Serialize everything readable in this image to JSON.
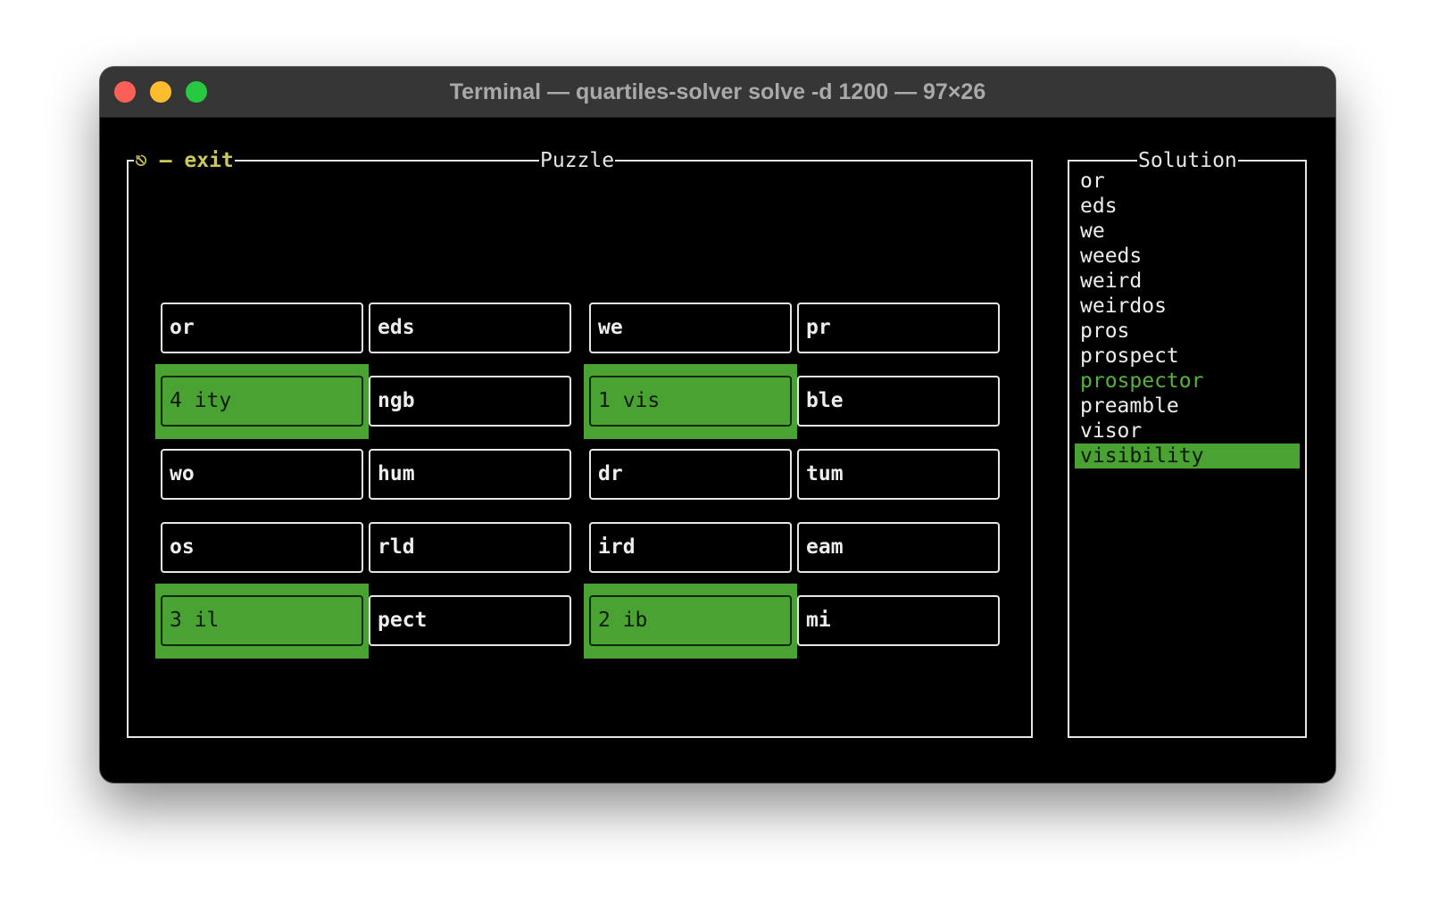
{
  "window": {
    "title": "Terminal — quartiles-solver solve -d 1200 — 97×26"
  },
  "puzzle_panel": {
    "title": "Puzzle",
    "exit_hint": "⎋ – exit",
    "tiles": [
      {
        "label": "or",
        "selected": false
      },
      {
        "label": "eds",
        "selected": false
      },
      {
        "label": "we",
        "selected": false
      },
      {
        "label": "pr",
        "selected": false
      },
      {
        "label": "4 ity",
        "selected": true
      },
      {
        "label": "ngb",
        "selected": false
      },
      {
        "label": "1 vis",
        "selected": true
      },
      {
        "label": "ble",
        "selected": false
      },
      {
        "label": "wo",
        "selected": false
      },
      {
        "label": "hum",
        "selected": false
      },
      {
        "label": "dr",
        "selected": false
      },
      {
        "label": "tum",
        "selected": false
      },
      {
        "label": "os",
        "selected": false
      },
      {
        "label": "rld",
        "selected": false
      },
      {
        "label": "ird",
        "selected": false
      },
      {
        "label": "eam",
        "selected": false
      },
      {
        "label": "3 il",
        "selected": true
      },
      {
        "label": "pect",
        "selected": false
      },
      {
        "label": "2 ib",
        "selected": true
      },
      {
        "label": "mi",
        "selected": false
      }
    ]
  },
  "solution_panel": {
    "title": "Solution",
    "words": [
      {
        "text": "or",
        "state": "normal"
      },
      {
        "text": "eds",
        "state": "normal"
      },
      {
        "text": "we",
        "state": "normal"
      },
      {
        "text": "weeds",
        "state": "normal"
      },
      {
        "text": "weird",
        "state": "normal"
      },
      {
        "text": "weirdos",
        "state": "normal"
      },
      {
        "text": "pros",
        "state": "normal"
      },
      {
        "text": "prospect",
        "state": "normal"
      },
      {
        "text": "prospector",
        "state": "found"
      },
      {
        "text": "preamble",
        "state": "normal"
      },
      {
        "text": "visor",
        "state": "normal"
      },
      {
        "text": "visibility",
        "state": "current"
      }
    ]
  },
  "colors": {
    "highlight_green": "#4aa232",
    "found_word_green": "#58b33a",
    "exit_hint_yellow": "#c9c85b",
    "border_white": "#e6e6e6"
  }
}
